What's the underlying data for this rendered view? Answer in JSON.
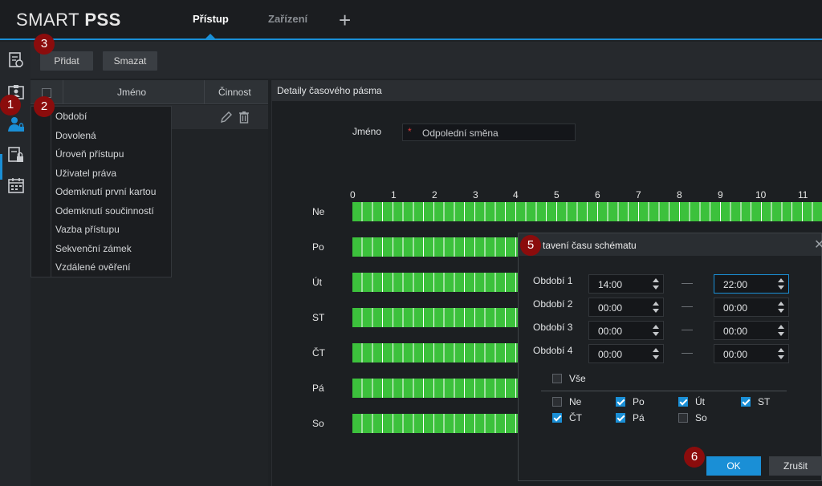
{
  "app": {
    "logo_regular": "SMART ",
    "logo_bold": "PSS"
  },
  "tabs": [
    {
      "label": "Přístup",
      "active": true
    },
    {
      "label": "Zařízení",
      "active": false
    }
  ],
  "add_tab_icon": "plus-icon",
  "rail_icons": [
    "log-icon",
    "person-card-icon",
    "person-lock-icon",
    "document-lock-icon",
    "calendar-icon"
  ],
  "toolbar": {
    "add_label": "Přidat",
    "delete_label": "Smazat"
  },
  "list": {
    "col_name": "Jméno",
    "col_action": "Činnost",
    "row_icons": [
      "pencil-icon",
      "trash-icon"
    ]
  },
  "dropdown_items": [
    "Období",
    "Dovolená",
    "Úroveň přístupu",
    "Uživatel práva",
    "Odemknutí první kartou",
    "Odemknutí součinností",
    "Vazba přístupu",
    "Sekvenční zámek",
    "Vzdálené ověření"
  ],
  "details": {
    "title": "Detaily časového pásma",
    "name_label": "Jméno",
    "required_marker": "*",
    "name_value": "Odpolední směna",
    "hours": [
      "0",
      "1",
      "2",
      "3",
      "4",
      "5",
      "6",
      "7",
      "8",
      "9",
      "10",
      "11"
    ],
    "days": [
      "Ne",
      "Po",
      "Út",
      "ST",
      "ČT",
      "Pá",
      "So"
    ]
  },
  "modal": {
    "title": "tavení času schématu",
    "periods": [
      {
        "label": "Období 1",
        "start": "14:00",
        "end": "22:00"
      },
      {
        "label": "Období 2",
        "start": "00:00",
        "end": "00:00"
      },
      {
        "label": "Období 3",
        "start": "00:00",
        "end": "00:00"
      },
      {
        "label": "Období 4",
        "start": "00:00",
        "end": "00:00"
      }
    ],
    "all_label": "Vše",
    "all_checked": false,
    "day_checks": [
      {
        "label": "Ne",
        "checked": false
      },
      {
        "label": "Po",
        "checked": true
      },
      {
        "label": "Út",
        "checked": true
      },
      {
        "label": "ST",
        "checked": true
      },
      {
        "label": "ČT",
        "checked": true
      },
      {
        "label": "Pá",
        "checked": true
      },
      {
        "label": "So",
        "checked": false
      }
    ],
    "ok_label": "OK",
    "cancel_label": "Zrušit",
    "close_icon": "close-icon"
  },
  "callouts": [
    "1",
    "2",
    "3",
    "5",
    "6"
  ],
  "colors": {
    "accent": "#1a8fd6",
    "schedule_green": "#3cc13c",
    "callout": "#8b0c0c"
  }
}
